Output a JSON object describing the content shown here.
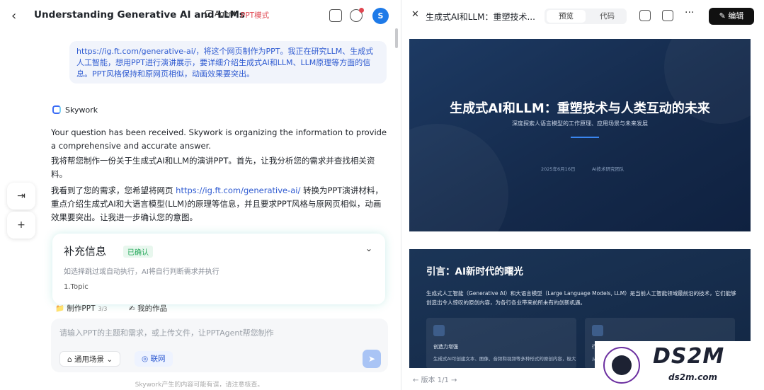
{
  "left": {
    "title": "Understanding Generative AI and LLMs",
    "agent_label": "Agent",
    "ppt_mode": "PPT模式",
    "avatar": "S",
    "user_message": "https://ig.ft.com/generative-ai/，将这个网页制作为PPT。我正在研究LLM、生成式人工智能，想用PPT进行演讲展示，要详细介绍生成式AI和LLM、LLM原理等方面的信息。PPT风格保持和原网页相似，动画效果要突出。",
    "assistant_name": "Skywork",
    "para1": "Your question has been received. Skywork is organizing the information to provide a comprehensive and accurate answer.",
    "para2": "我将帮您制作一份关于生成式AI和LLM的演讲PPT。首先，让我分析您的需求并查找相关资料。",
    "para3_pre": "我看到了您的需求，您希望将网页 ",
    "para3_link": "https://ig.ft.com/generative-ai/",
    "para3_post": " 转换为PPT演讲材料，重点介绍生成式AI和大语言模型(LLM)的原理等信息，并且要求PPT风格与原网页相似，动画效果要突出。让我进一步确认您的意图。",
    "supp_title": "补充信息",
    "supp_status": "已确认",
    "supp_hint": "如选择跳过或自动执行，AI将自行判断需求并执行",
    "supp_topic": "1.Topic",
    "chip1": "制作PPT",
    "chip1_count": "3/3",
    "chip2": "我的作品",
    "input_placeholder": "请输入PPT的主题和需求，或上传文件，让PPTAgent帮您制作",
    "scene_btn": "通用场景",
    "web_btn": "联网",
    "footer": "Skywork产生的内容可能有误，请注意核查。"
  },
  "right": {
    "title": "生成式AI和LLM：重塑技术...",
    "tab_preview": "预览",
    "tab_code": "代码",
    "edit_btn": "编辑",
    "slide1_title": "生成式AI和LLM：重塑技术与人类互动的未来",
    "slide1_sub": "深度探索人语言模型的工作原理、应用场景与未来发展",
    "slide1_date": "2025年6月16日",
    "slide1_org": "AI技术研究团队",
    "slide2_title": "引言：AI新时代的曙光",
    "slide2_body": "生成式人工智能（Generative AI）和大语言模型（Large Language Models, LLM）是当前人工智能领域最前沿的技术，它们能够创造出令人惊叹的原创内容，为各行各业带来前所未有的创新机遇。",
    "card1_title": "创造力增强",
    "card1_desc": "生成式AI可创建文本、图像、音频和视频等多种形式的原创内容，极大",
    "card2_title": "行",
    "card2_desc": "从",
    "pager": "版本 1/1"
  },
  "watermark": {
    "big": "DS2M",
    "small": "ds2m.com"
  }
}
